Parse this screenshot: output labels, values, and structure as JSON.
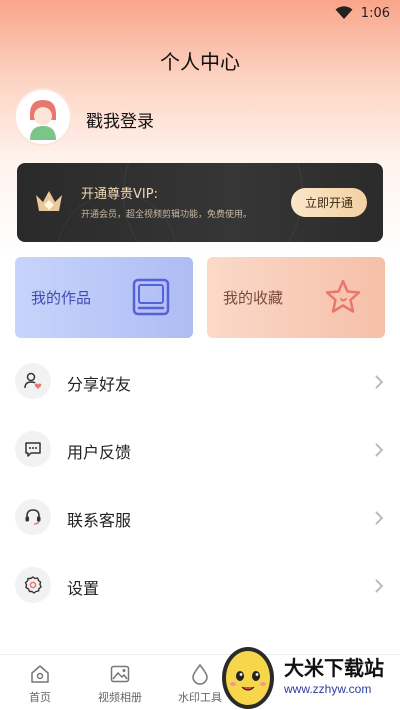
{
  "status_bar": {
    "time": "1:06"
  },
  "header": {
    "title": "个人中心"
  },
  "profile": {
    "login_text": "戳我登录"
  },
  "vip": {
    "title": "开通尊贵VIP:",
    "description": "开通会员，超全视频剪辑功能，免费使用。",
    "button_label": "立即开通"
  },
  "tiles": {
    "works_label": "我的作品",
    "favorites_label": "我的收藏"
  },
  "menu": {
    "items": [
      {
        "label": "分享好友",
        "icon": "share-user-icon"
      },
      {
        "label": "用户反馈",
        "icon": "feedback-icon"
      },
      {
        "label": "联系客服",
        "icon": "headset-icon"
      },
      {
        "label": "设置",
        "icon": "settings-gear-icon"
      }
    ]
  },
  "tabbar": {
    "tabs": [
      {
        "label": "首页",
        "icon": "home-icon"
      },
      {
        "label": "视频相册",
        "icon": "photo-album-icon"
      },
      {
        "label": "水印工具",
        "icon": "watermark-icon"
      }
    ]
  },
  "watermark_overlay": {
    "title": "大米下载站",
    "url": "www.zzhyw.com"
  },
  "colors": {
    "accent_orange": "#f9a58a",
    "vip_gold": "#f2d9b3",
    "works_blue": "#3d4cb3",
    "favorites_red": "#e8776e"
  }
}
